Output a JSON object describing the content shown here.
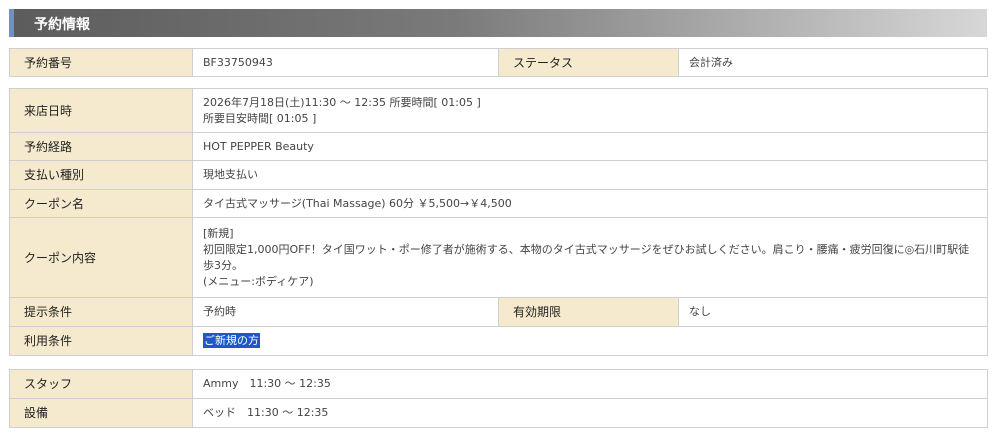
{
  "section": {
    "title": "予約情報"
  },
  "reservation": {
    "number_label": "予約番号",
    "number_value": "BF33750943",
    "status_label": "ステータス",
    "status_value": "会計済み"
  },
  "details": {
    "visit_label": "来店日時",
    "visit_line1": "2026年7月18日(土)11:30 ～ 12:35 所要時間[ 01:05 ]",
    "visit_line2": "所要目安時間[ 01:05 ]",
    "route_label": "予約経路",
    "route_value": "HOT PEPPER Beauty",
    "payment_label": "支払い種別",
    "payment_value": "現地支払い",
    "coupon_name_label": "クーポン名",
    "coupon_name_value": "タイ古式マッサージ(Thai Massage) 60分 ￥5,500→￥4,500",
    "coupon_content_label": "クーポン内容",
    "coupon_content_line1": "[新規]",
    "coupon_content_line2": "初回限定1,000円OFF！タイ国ワット・ポー修了者が施術する、本物のタイ古式マッサージをぜひお試しください。肩こり・腰痛・疲労回復に◎石川町駅徒",
    "coupon_content_line3": "歩3分。",
    "coupon_content_line4": "(メニュー:ボディケア)",
    "present_label": "提示条件",
    "present_value": "予約時",
    "expiry_label": "有効期限",
    "expiry_value": "なし",
    "usage_label": "利用条件",
    "usage_value": "ご新規の方"
  },
  "resources": {
    "staff_label": "スタッフ",
    "staff_value": "Ammy　11:30 ～ 12:35",
    "equipment_label": "設備",
    "equipment_value": "ベッド　11:30 ～ 12:35"
  }
}
